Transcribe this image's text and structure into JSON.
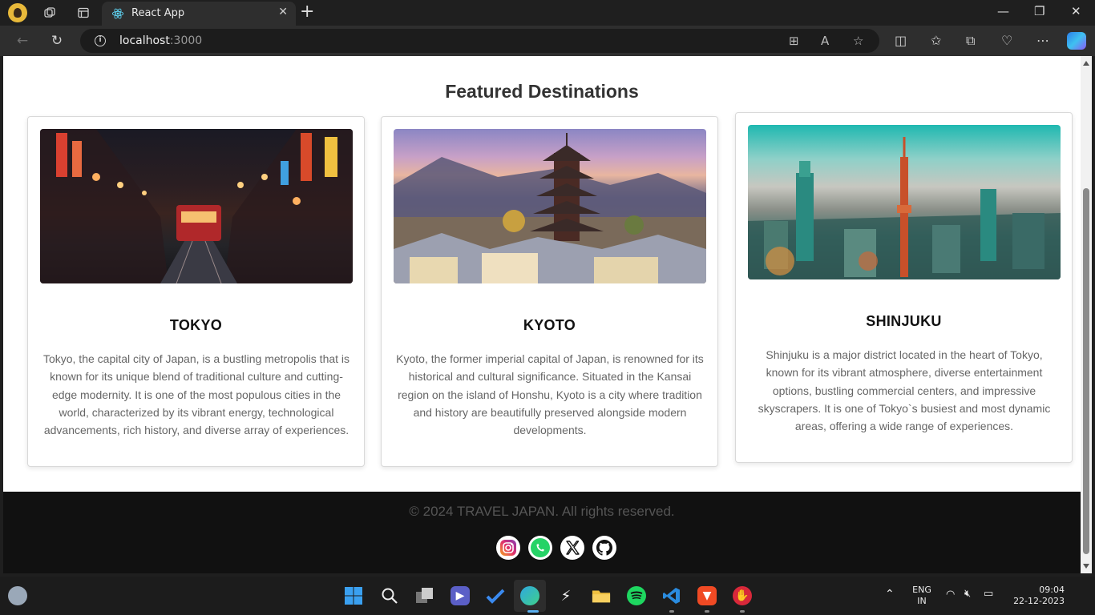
{
  "browser": {
    "tab_title": "React App",
    "tab_close": "✕",
    "url_host": "localhost",
    "url_port": ":3000"
  },
  "page": {
    "heading": "Featured Destinations",
    "cards": [
      {
        "title": "TOKYO",
        "description": "Tokyo, the capital city of Japan, is a bustling metropolis that is known for its unique blend of traditional culture and cutting-edge modernity. It is one of the most populous cities in the world, characterized by its vibrant energy, technological advancements, rich history, and diverse array of experiences.",
        "image_alt": "tokyo-street-night-image"
      },
      {
        "title": "KYOTO",
        "description": "Kyoto, the former imperial capital of Japan, is renowned for its historical and cultural significance. Situated in the Kansai region on the island of Honshu, Kyoto is a city where tradition and history are beautifully preserved alongside modern developments.",
        "image_alt": "kyoto-pagoda-image"
      },
      {
        "title": "SHINJUKU",
        "description": "Shinjuku is a major district located in the heart of Tokyo, known for its vibrant atmosphere, diverse entertainment options, bustling commercial centers, and impressive skyscrapers. It is one of Tokyo`s busiest and most dynamic areas, offering a wide range of experiences.",
        "image_alt": "shinjuku-skyline-image"
      }
    ],
    "footer": {
      "copyright": "© 2024 TRAVEL JAPAN. All rights reserved.",
      "social_links": [
        "instagram-icon",
        "whatsapp-icon",
        "x-icon",
        "github-icon"
      ]
    }
  },
  "taskbar": {
    "language_line1": "ENG",
    "language_line2": "IN",
    "time": "09:04",
    "date": "22-12-2023"
  },
  "colors": {
    "heading": "#333333",
    "footer_bg": "#111111",
    "card_border": "#d9d9d9",
    "description_text": "#666666"
  }
}
